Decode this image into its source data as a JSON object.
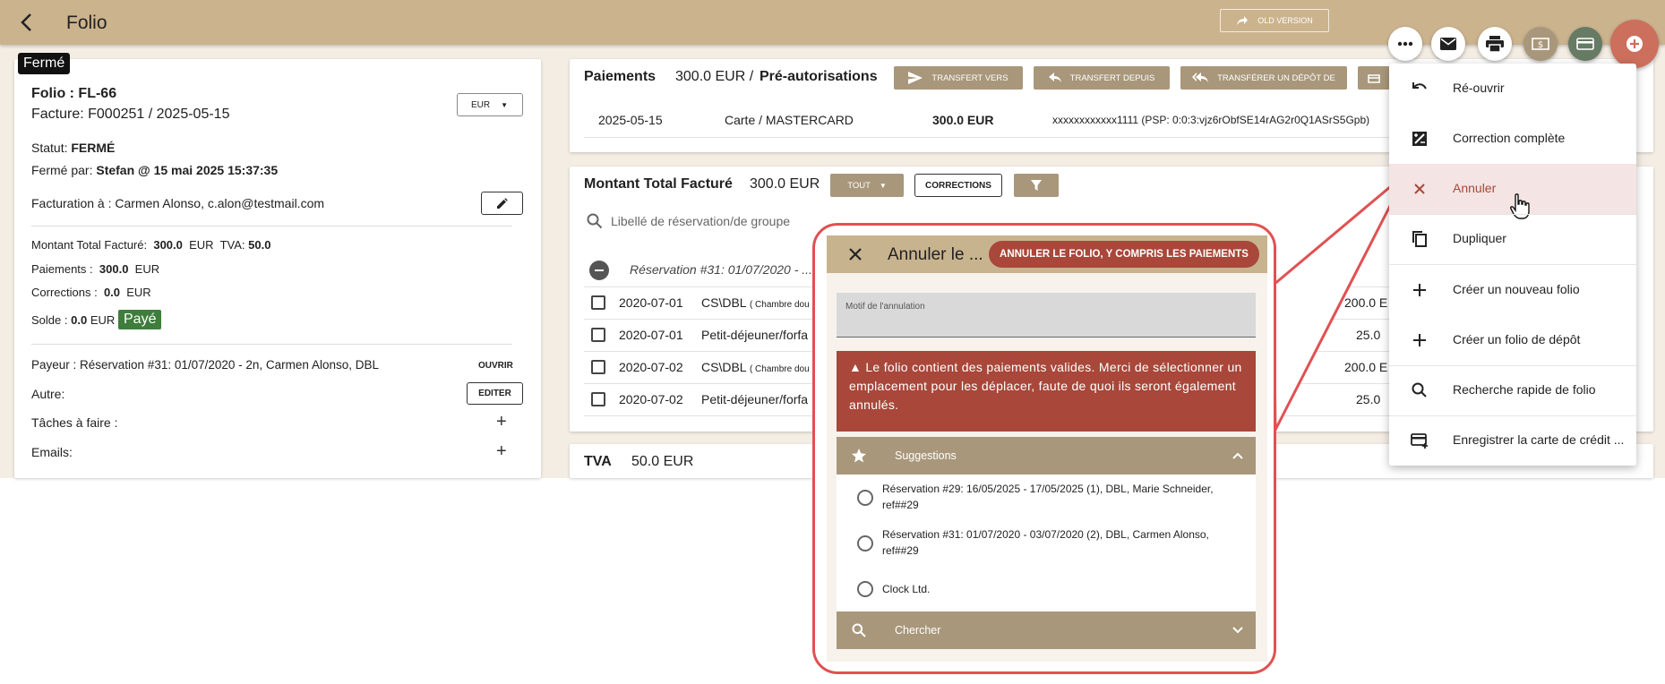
{
  "topbar": {
    "title": "Folio",
    "old_version": "OLD VERSION"
  },
  "left": {
    "status_tag": "Fermé",
    "folio": "Folio : FL-66",
    "facture": "Facture: F000251 / 2025-05-15",
    "currency": "EUR",
    "statut_label": "Statut:",
    "statut_value": "FERMÉ",
    "ferme_par_label": "Fermé par:",
    "ferme_par_value": "Stefan @ 15 mai 2025 15:37:35",
    "facturation": "Facturation à : Carmen Alonso, c.alon@testmail.com",
    "montant_label": "Montant Total Facturé:",
    "montant_value": "300.0",
    "montant_cur": "EUR",
    "tva_label": "TVA:",
    "tva_value": "50.0",
    "paiements_label": "Paiements :",
    "paiements_value": "300.0",
    "paiements_cur": "EUR",
    "corrections_label": "Corrections :",
    "corrections_value": "0.0",
    "corrections_cur": "EUR",
    "solde_label": "Solde :",
    "solde_value": "0.0",
    "solde_cur": "EUR",
    "paye": "Payé",
    "payeur": "Payeur : Réservation #31: 01/07/2020 - 2n, Carmen Alonso, DBL",
    "ouvrir": "OUVRIR",
    "autre": "Autre:",
    "editer": "EDITER",
    "taches": "Tâches à faire :",
    "emails": "Emails:"
  },
  "payments": {
    "title": "Paiements",
    "amount": "300.0 EUR /",
    "preauth": "Pré-autorisations",
    "btn_transfert_vers": "TRANSFERT VERS",
    "btn_transfert_depuis": "TRANSFERT DEPUIS",
    "btn_transferer_depot": "TRANSFÉRER UN DÉPÔT DE",
    "row": {
      "date": "2025-05-15",
      "method": "Carte / MASTERCARD",
      "amount": "300.0 EUR",
      "ref": "xxxxxxxxxxxx1111 (PSP: 0:0:3:vjz6rObfSE14rAG2r0Q1ASrS5Gpb)"
    }
  },
  "montant": {
    "title": "Montant Total Facturé",
    "amount": "300.0 EUR",
    "btn_tout": "TOUT",
    "btn_corrections": "CORRECTIONS",
    "search_placeholder": "Libellé de réservation/de groupe",
    "group_label": "Réservation #31: 01/07/2020 - ...",
    "rows": [
      {
        "date": "2020-07-01",
        "desc": "CS\\DBL",
        "note": "( Chambre dou",
        "amount": "200.0 E"
      },
      {
        "date": "2020-07-01",
        "desc": "Petit-déjeuner/forfa",
        "note": "",
        "amount": "25.0"
      },
      {
        "date": "2020-07-02",
        "desc": "CS\\DBL",
        "note": "( Chambre dou",
        "amount": "200.0 E"
      },
      {
        "date": "2020-07-02",
        "desc": "Petit-déjeuner/forfa",
        "note": "",
        "amount": "25.0"
      }
    ]
  },
  "tva": {
    "title": "TVA",
    "amount": "50.0 EUR"
  },
  "dialog": {
    "title": "Annuler le ...",
    "cancel_all": "ANNULER LE FOLIO, Y COMPRIS LES PAIEMENTS",
    "motif_label": "Motif de l'annulation",
    "motif_value": "",
    "alert": "▲ Le folio contient des paiements valides. Merci de sélectionner un emplacement pour les déplacer, faute de quoi ils seront également annulés.",
    "suggestions_title": "Suggestions",
    "suggestions": [
      "Réservation #29: 16/05/2025 - 17/05/2025 (1), DBL, Marie Schneider, ref##29",
      "Réservation #31: 01/07/2020 - 03/07/2020 (2), DBL, Carmen Alonso, ref##29",
      "Clock Ltd."
    ],
    "search_title": "Chercher"
  },
  "menu": {
    "items": [
      {
        "label": "Ré-ouvrir",
        "icon": "undo-icon"
      },
      {
        "label": "Correction complète",
        "icon": "correction-icon"
      },
      {
        "label": "Annuler",
        "icon": "close-icon"
      },
      {
        "label": "Dupliquer",
        "icon": "copy-icon"
      },
      {
        "label": "Créer un nouveau folio",
        "icon": "plus-icon"
      },
      {
        "label": "Créer un folio de dépôt",
        "icon": "plus-icon"
      },
      {
        "label": "Recherche rapide de folio",
        "icon": "search-icon"
      },
      {
        "label": "Enregistrer la carte de crédit ...",
        "icon": "credit-card-add-icon"
      }
    ]
  },
  "colors": {
    "topbar": "#cbb38e",
    "tan_button": "#a8977a",
    "danger": "#a8473a",
    "highlight_red": "#e25052",
    "paid_green": "#3e7d3c",
    "fab_green": "#667a64"
  }
}
